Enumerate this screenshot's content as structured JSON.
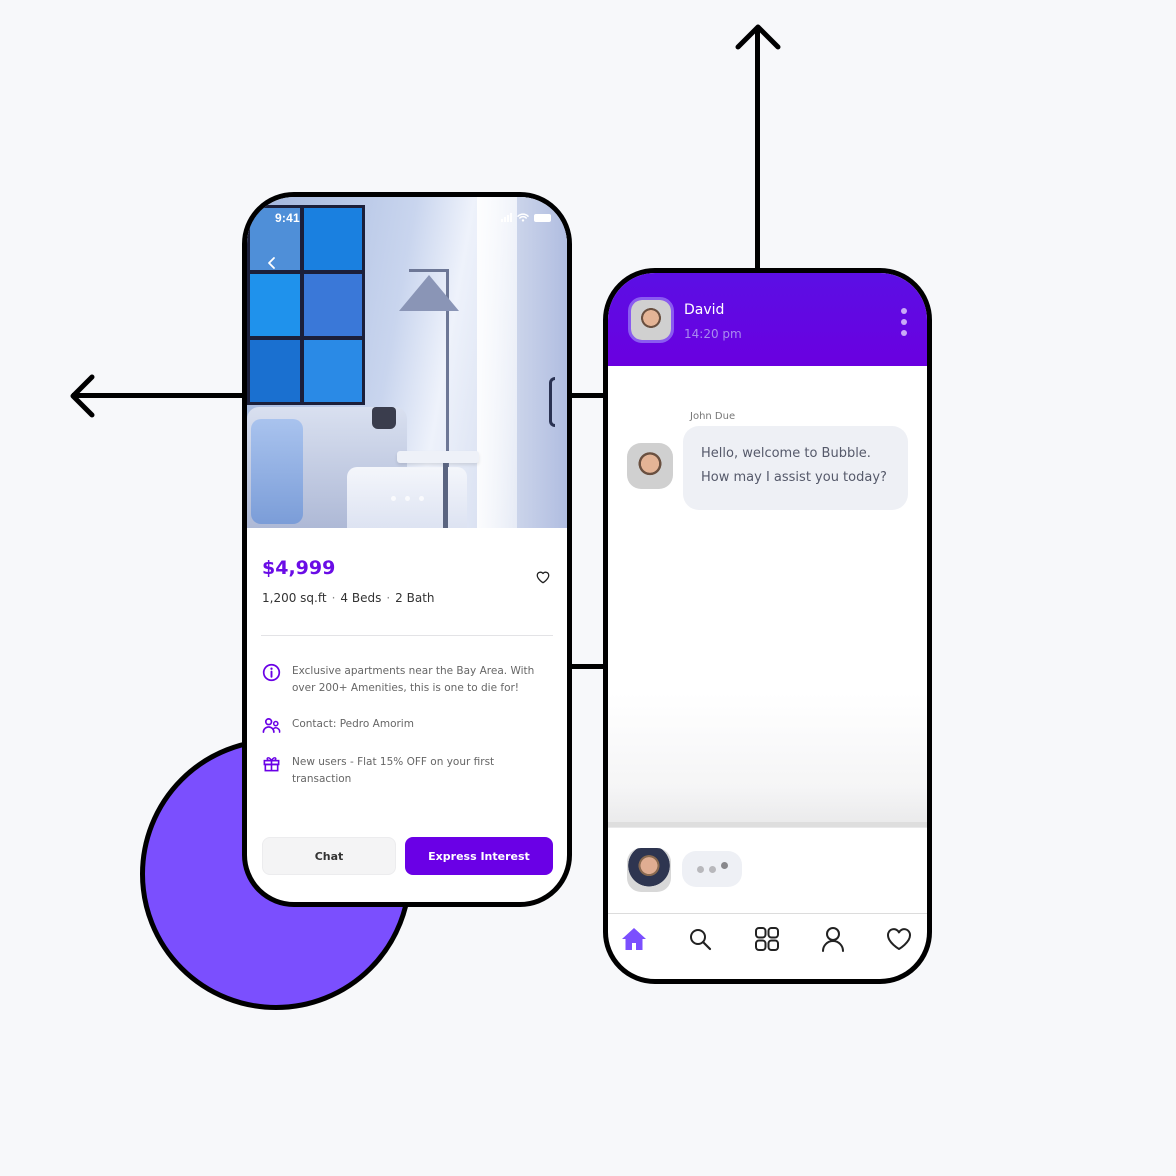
{
  "listing_phone": {
    "status_bar": {
      "time": "9:41"
    },
    "back_icon": "chevron-left-icon",
    "image_dots": 3,
    "price": "$4,999",
    "specs": [
      "1,200 sq.ft",
      "4 Beds",
      "2 Bath"
    ],
    "spec_separator": "·",
    "favorite_icon": "heart-outline-icon",
    "info_items": [
      {
        "icon": "info-icon",
        "text": "Exclusive apartments near the Bay Area. With over 200+ Amenities, this is one to die for!"
      },
      {
        "icon": "users-icon",
        "text": "Contact: Pedro Amorim"
      },
      {
        "icon": "gift-icon",
        "text": "New users - Flat 15% OFF on your first transaction"
      }
    ],
    "buttons": {
      "chat": "Chat",
      "express_interest": "Express Interest"
    }
  },
  "chat_phone": {
    "header": {
      "name": "David",
      "time": "14:20 pm",
      "menu_icon": "kebab-menu-icon"
    },
    "messages": [
      {
        "sender": "John Due",
        "lines": [
          "Hello, welcome to Bubble.",
          "How may I assist you today?"
        ]
      }
    ],
    "typing_indicator": true,
    "nav": [
      {
        "icon": "home-icon",
        "active": true
      },
      {
        "icon": "search-icon",
        "active": false
      },
      {
        "icon": "grid-icon",
        "active": false
      },
      {
        "icon": "user-icon",
        "active": false
      },
      {
        "icon": "heart-icon",
        "active": false
      }
    ]
  },
  "colors": {
    "accent": "#6a00e6",
    "circle": "#7b4ffe",
    "background": "#f7f8fa",
    "header": "#5b0fe4"
  }
}
